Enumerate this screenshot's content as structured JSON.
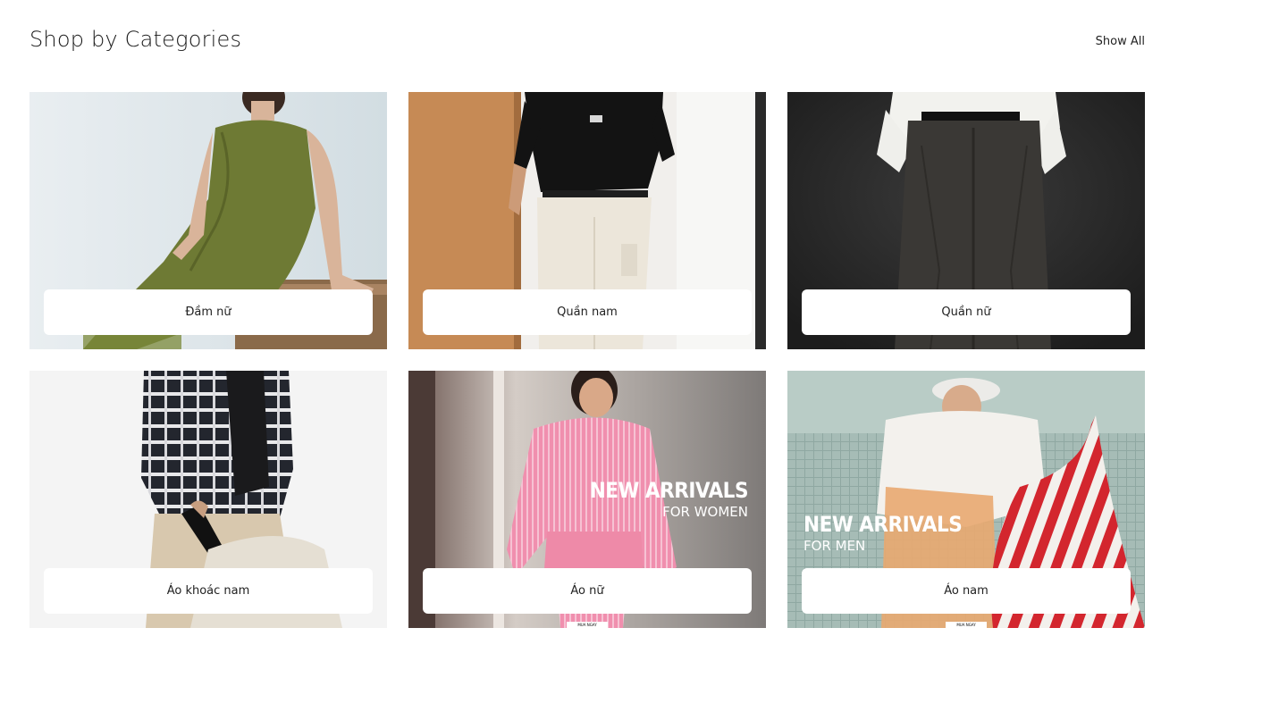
{
  "section": {
    "title": "Shop by Categories",
    "show_all_label": "Show All"
  },
  "categories": [
    {
      "label": "Đầm nữ",
      "image": "woman-green-dress-photo"
    },
    {
      "label": "Quần nam",
      "image": "man-black-tee-white-pants-photo"
    },
    {
      "label": "Quần nữ",
      "image": "dark-trousers-white-shirt-photo"
    },
    {
      "label": "Áo khoác nam",
      "image": "plaid-jacket-tote-bag-photo"
    },
    {
      "label": "Áo nữ",
      "image": "woman-pink-striped-shirt-photo",
      "promo": {
        "line1": "NEW ARRIVALS",
        "line2": "FOR WOMEN",
        "tag": "MUA NGAY"
      }
    },
    {
      "label": "Áo nam",
      "image": "man-white-tee-striped-bag-photo",
      "promo": {
        "line1": "NEW ARRIVALS",
        "line2": "FOR MEN",
        "tag": "MUA NGAY"
      }
    }
  ]
}
